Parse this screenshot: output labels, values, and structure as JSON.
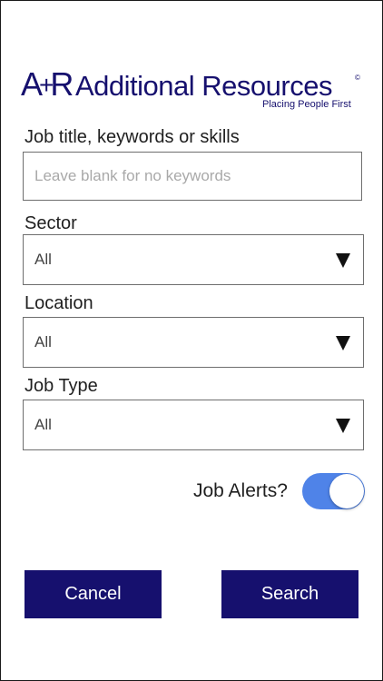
{
  "logo": {
    "mark_a": "A",
    "mark_plus": "+",
    "mark_r": "R",
    "name": "Additional Resources",
    "registered": "©",
    "tagline": "Placing People First"
  },
  "form": {
    "keywords": {
      "label": "Job title, keywords or skills",
      "value": "",
      "placeholder": "Leave blank for no keywords"
    },
    "sector": {
      "label": "Sector",
      "value": "All"
    },
    "location": {
      "label": "Location",
      "value": "All"
    },
    "job_type": {
      "label": "Job Type",
      "value": "All"
    },
    "job_alerts": {
      "label": "Job Alerts?",
      "enabled": true,
      "color": "#4f83e8"
    }
  },
  "actions": {
    "cancel_label": "Cancel",
    "search_label": "Search",
    "button_color": "#16106e"
  }
}
